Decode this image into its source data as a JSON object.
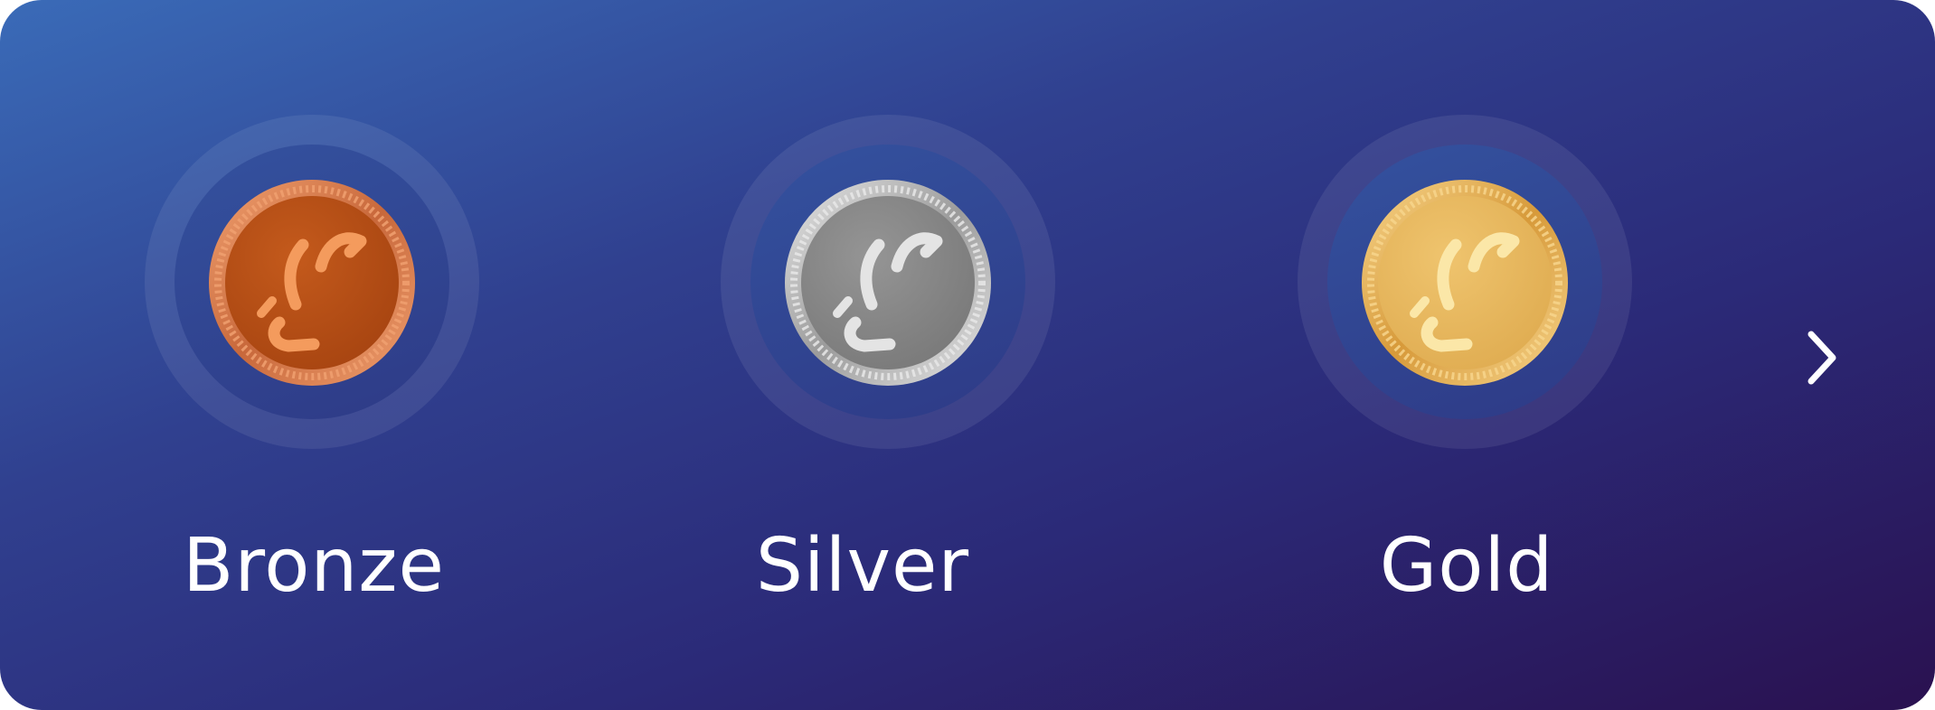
{
  "tiers": [
    {
      "label": "Bronze",
      "icon": "bronze-coin-icon",
      "colors": {
        "rim": "#c8683b",
        "rim_light": "#f0a070",
        "face": "#a84511",
        "face_light": "#c45a1c",
        "mark": "#f49b5d"
      }
    },
    {
      "label": "Silver",
      "icon": "silver-coin-icon",
      "colors": {
        "rim": "#9b9b9b",
        "rim_light": "#e8e8e8",
        "face": "#7a7a7a",
        "face_light": "#959595",
        "mark": "#e4e4e4"
      }
    },
    {
      "label": "Gold",
      "icon": "gold-coin-icon",
      "colors": {
        "rim": "#d79a3a",
        "rim_light": "#f7d58c",
        "face": "#e0ad52",
        "face_light": "#efc46e",
        "mark": "#fbe7a8"
      }
    }
  ],
  "navigation": {
    "next_icon": "chevron-right-icon"
  },
  "theme": {
    "background_start": "#3a6bb8",
    "background_end": "#2a1150",
    "text": "#ffffff"
  }
}
